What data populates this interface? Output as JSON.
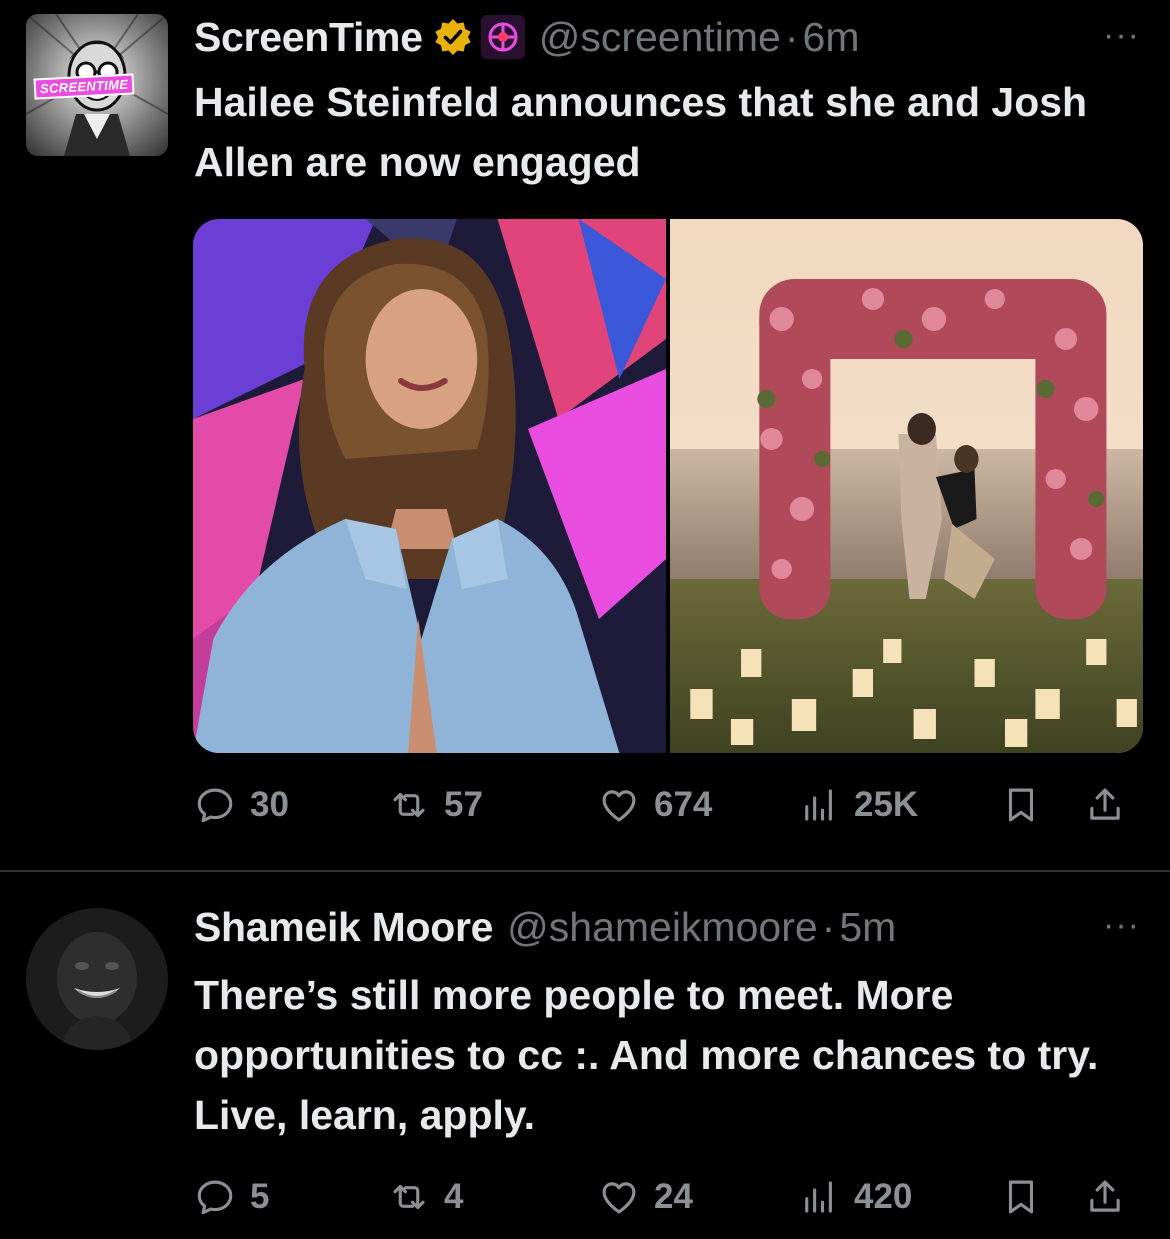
{
  "tweets": [
    {
      "display_name": "ScreenTime",
      "handle": "@screentime",
      "separator": "·",
      "time": "6m",
      "avatar_badge": "SCREENTIME",
      "verified_icon": "gold-verified-badge-icon",
      "affiliate_icon": "affiliate-logo-icon",
      "text": "Hailee Steinfeld announces that she and Josh Allen are now engaged",
      "media": [
        {
          "description": "photo-woman-denim-shirt"
        },
        {
          "description": "photo-proposal-flower-arch"
        }
      ],
      "actions": {
        "replies": "30",
        "reposts": "57",
        "likes": "674",
        "views": "25K"
      }
    },
    {
      "display_name": "Shameik Moore",
      "handle": "@shameikmoore",
      "separator": "·",
      "time": "5m",
      "text": "There’s still more people to meet. More opportunities to cc    :. And more chances to try. Live, learn, apply.",
      "actions": {
        "replies": "5",
        "reposts": "4",
        "likes": "24",
        "views": "420"
      }
    }
  ],
  "more_icon": "···",
  "colors": {
    "background": "#000000",
    "text_primary": "#e7e9ea",
    "text_secondary": "#71767b",
    "divider": "#2f3336",
    "verified_gold": "#e8b20c"
  }
}
